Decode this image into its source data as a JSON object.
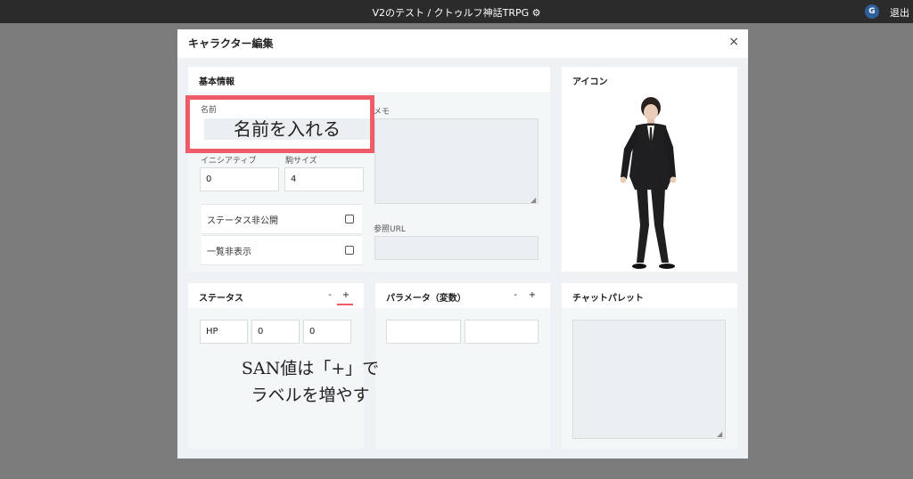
{
  "window": {
    "title": "V2のテスト / クトゥルフ神話TRPG ⚙",
    "avatar_initial": "G",
    "logout_label": "退出"
  },
  "modal": {
    "title": "キャラクター編集",
    "close_glyph": "×"
  },
  "basic_info": {
    "header": "基本情報",
    "name_label": "名前",
    "name_overlay_text": "名前を入れる",
    "initiative_label": "イニシアティブ",
    "initiative_value": "0",
    "piece_size_label": "駒サイズ",
    "piece_size_value": "4",
    "memo_label": "メモ",
    "status_private_label": "ステータス非公開",
    "status_private_checked": false,
    "list_hidden_label": "一覧非表示",
    "list_hidden_checked": false,
    "reference_url_label": "参照URL",
    "reference_url_value": ""
  },
  "icon_panel": {
    "header": "アイコン"
  },
  "status_panel": {
    "header": "ステータス",
    "minus_label": "-",
    "plus_label": "+",
    "row": {
      "label": "HP",
      "value": "0",
      "max": "0"
    }
  },
  "parameter_panel": {
    "header": "パラメータ（変数）",
    "minus_label": "-",
    "plus_label": "+"
  },
  "chat_palette_panel": {
    "header": "チャットパレット"
  },
  "annotation": {
    "line1": "SAN値は「+」で",
    "line2": "ラベルを増やす"
  },
  "colors": {
    "annotation_red": "#ef5b67",
    "topbar": "#2b2b2b",
    "backdrop": "#7c7c7c"
  }
}
